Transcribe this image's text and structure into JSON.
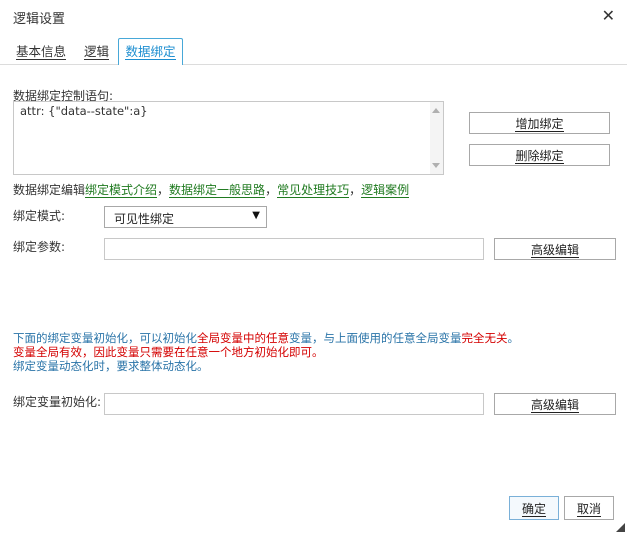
{
  "dialog": {
    "title": "逻辑设置",
    "close_glyph": "✕"
  },
  "tabs": [
    {
      "label": "基本信息",
      "active": false
    },
    {
      "label": "逻辑",
      "active": false
    },
    {
      "label": "数据绑定",
      "active": true
    }
  ],
  "binding_statement": {
    "label": "数据绑定控制语句:",
    "value": "attr: {\"data--state\":a}"
  },
  "buttons": {
    "add_binding": "增加绑定",
    "delete_binding": "删除绑定",
    "advanced_edit_1": "高级编辑",
    "advanced_edit_2": "高级编辑",
    "confirm": "确定",
    "cancel": "取消"
  },
  "help_links": {
    "prefix": "数据绑定编辑",
    "separator": "，",
    "items": [
      "绑定模式介绍",
      "数据绑定一般思路",
      "常见处理技巧",
      "逻辑案例"
    ]
  },
  "binding_mode": {
    "label": "绑定模式:",
    "selected": "可见性绑定"
  },
  "binding_params": {
    "label": "绑定参数:",
    "value": ""
  },
  "info_text": {
    "line1_a": "下面的绑定变量初始化，可以初始化",
    "line1_b": "全局变量中的任意",
    "line1_c": "变量，与上面使用的任意全局变量",
    "line1_d": "完全无关",
    "line1_e": "。",
    "line2": "变量全局有效，因此变量只需要在任意一个地方初始化即可。",
    "line3": "绑定变量动态化时，要求整体动态化。"
  },
  "var_init": {
    "label": "绑定变量初始化:",
    "value": ""
  },
  "colors": {
    "accent": "#1d8ed0",
    "link": "#1f7a1f",
    "info_blue": "#2a74a8",
    "warning_red": "#d40000"
  }
}
